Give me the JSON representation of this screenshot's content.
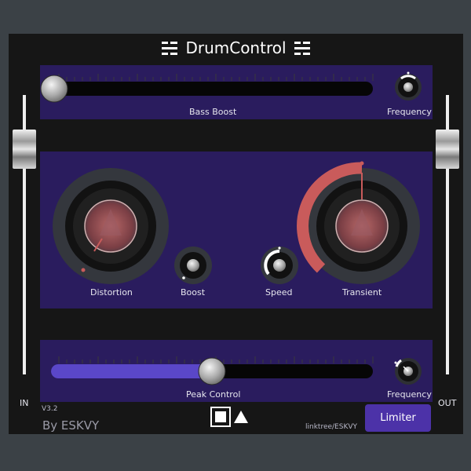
{
  "header": {
    "title": "DrumControl"
  },
  "top_panel": {
    "slider_label": "Bass Boost",
    "knob_label": "Frequency",
    "bass_boost_value": 0.0
  },
  "middle_panel": {
    "knobs": [
      {
        "label": "Distortion",
        "value": 0.05
      },
      {
        "label": "Boost",
        "value": 0.0
      },
      {
        "label": "Speed",
        "value": 0.5
      },
      {
        "label": "Transient",
        "value": 0.5
      }
    ]
  },
  "bottom_panel": {
    "slider_label": "Peak Control",
    "knob_label": "Frequency",
    "peak_control_value": 0.5
  },
  "meters": {
    "in_label": "IN",
    "out_label": "OUT"
  },
  "footer": {
    "version": "V3.2",
    "author": "By ESKVY",
    "link": "linktree/ESKVY",
    "limiter_label": "Limiter"
  },
  "colors": {
    "panel": "#2a1c5e",
    "accent": "#c95b5b",
    "slider_fill": "#5a47c8",
    "limiter": "#4c32a8"
  }
}
